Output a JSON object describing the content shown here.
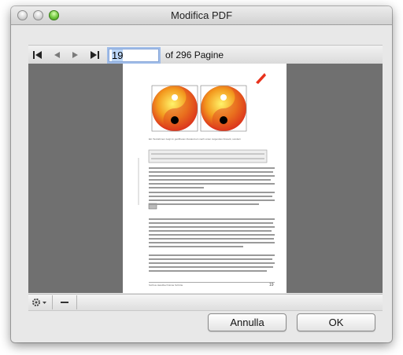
{
  "window": {
    "title": "Modifica PDF"
  },
  "navigation": {
    "current_page": "19",
    "total_label": "of 296 Pagine"
  },
  "document": {
    "caption": "Ein Textrahmen zeigt im geöffneten Zustand ein nach unten zeigendes Dreieck, sondern",
    "footer_left": "Scribus Handbuch  Erste Schritte",
    "footer_page": "19"
  },
  "buttons": {
    "cancel": "Annulla",
    "ok": "OK"
  },
  "colors": {
    "accent": "#3d7ae0",
    "viewer_bg": "#707070"
  }
}
